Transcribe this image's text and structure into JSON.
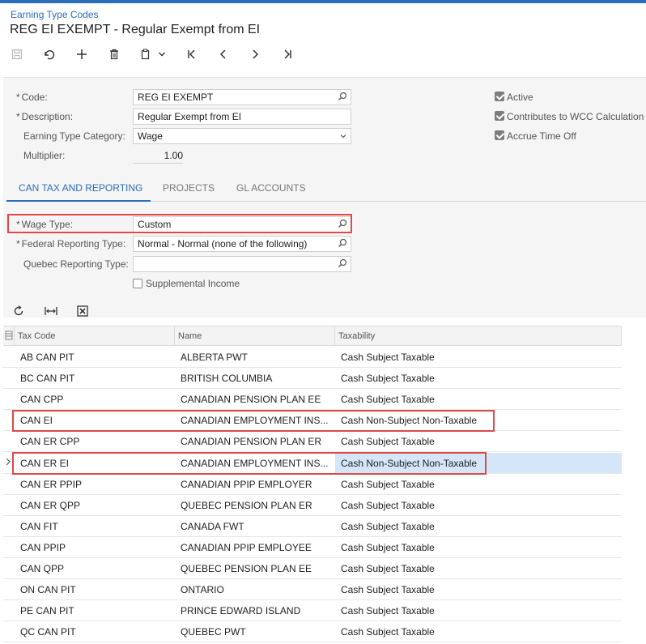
{
  "header": {
    "breadcrumb": "Earning Type Codes",
    "title": "REG EI EXEMPT - Regular Exempt from EI"
  },
  "toolbar": {
    "icons": [
      "save-icon",
      "undo-icon",
      "add-icon",
      "delete-icon",
      "copy-paste-icon",
      "chevron-down-icon",
      "first-record-icon",
      "previous-record-icon",
      "next-record-icon",
      "last-record-icon"
    ]
  },
  "form": {
    "code_label": "Code:",
    "code_value": "REG EI EXEMPT",
    "description_label": "Description:",
    "description_value": "Regular Exempt from EI",
    "category_label": "Earning Type Category:",
    "category_value": "Wage",
    "multiplier_label": "Multiplier:",
    "multiplier_value": "1.00",
    "required_mark": "*",
    "active_label": "Active",
    "active_checked": true,
    "wcc_label": "Contributes to WCC Calculation",
    "wcc_checked": true,
    "accrue_label": "Accrue Time Off",
    "accrue_checked": true
  },
  "tabs": [
    {
      "label": "CAN TAX AND REPORTING",
      "active": true
    },
    {
      "label": "PROJECTS",
      "active": false
    },
    {
      "label": "GL ACCOUNTS",
      "active": false
    }
  ],
  "tax": {
    "wage_type_label": "Wage Type:",
    "wage_type_value": "Custom",
    "federal_label": "Federal Reporting Type:",
    "federal_value": "Normal - Normal (none of the following)",
    "quebec_label": "Quebec Reporting Type:",
    "quebec_value": "",
    "supplemental_label": "Supplemental Income",
    "supplemental_checked": false
  },
  "grid": {
    "toolbar_icons": [
      "refresh-icon",
      "fit-columns-icon",
      "export-excel-icon"
    ],
    "columns": [
      "Tax Code",
      "Name",
      "Taxability"
    ],
    "selected_index": 5,
    "rows": [
      {
        "code": "AB CAN PIT",
        "name": "ALBERTA PWT",
        "taxability": "Cash Subject Taxable"
      },
      {
        "code": "BC CAN PIT",
        "name": "BRITISH COLUMBIA",
        "taxability": "Cash Subject Taxable"
      },
      {
        "code": "CAN CPP",
        "name": "CANADIAN PENSION PLAN EE",
        "taxability": "Cash Subject Taxable"
      },
      {
        "code": "CAN EI",
        "name": "CANADIAN EMPLOYMENT INS...",
        "taxability": "Cash Non-Subject Non-Taxable"
      },
      {
        "code": "CAN ER CPP",
        "name": "CANADIAN PENSION PLAN ER",
        "taxability": "Cash Subject Taxable"
      },
      {
        "code": "CAN ER EI",
        "name": "CANADIAN EMPLOYMENT INS...",
        "taxability": "Cash Non-Subject Non-Taxable"
      },
      {
        "code": "CAN ER PPIP",
        "name": "CANADIAN PPIP EMPLOYER",
        "taxability": "Cash Subject Taxable"
      },
      {
        "code": "CAN ER QPP",
        "name": "QUEBEC PENSION PLAN ER",
        "taxability": "Cash Subject Taxable"
      },
      {
        "code": "CAN FIT",
        "name": "CANADA FWT",
        "taxability": "Cash Subject Taxable"
      },
      {
        "code": "CAN PPIP",
        "name": "CANADIAN PPIP EMPLOYEE",
        "taxability": "Cash Subject Taxable"
      },
      {
        "code": "CAN QPP",
        "name": "QUEBEC PENSION PLAN EE",
        "taxability": "Cash Subject Taxable"
      },
      {
        "code": "ON CAN PIT",
        "name": "ONTARIO",
        "taxability": "Cash Subject Taxable"
      },
      {
        "code": "PE CAN PIT",
        "name": "PRINCE EDWARD ISLAND",
        "taxability": "Cash Subject Taxable"
      },
      {
        "code": "QC CAN PIT",
        "name": "QUEBEC PWT",
        "taxability": "Cash Subject Taxable"
      }
    ]
  },
  "colors": {
    "accent": "#2a6ebb",
    "highlight_box": "#e04848",
    "selected_row": "#d4e6f7"
  }
}
